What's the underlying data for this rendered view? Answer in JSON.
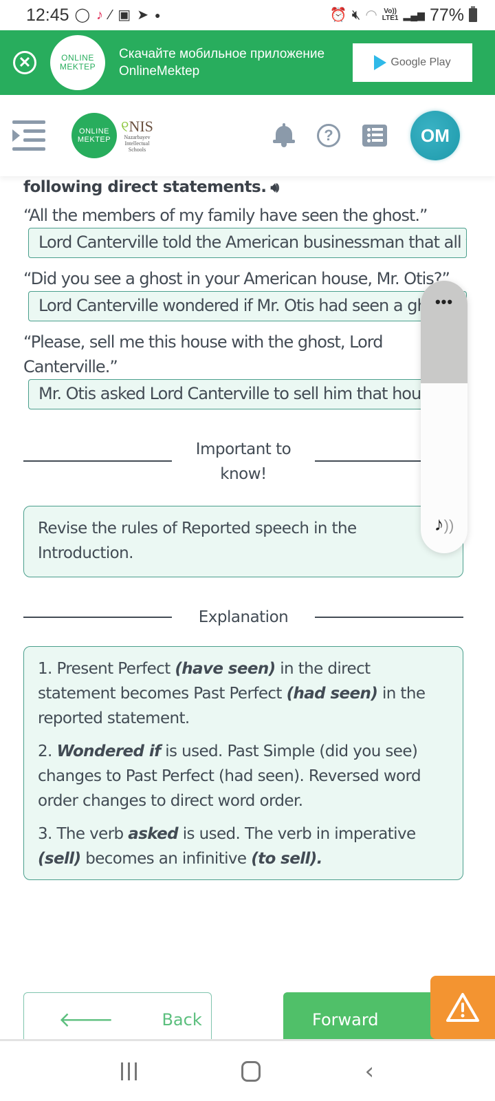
{
  "status_bar": {
    "time": "12:45",
    "notification_icons": [
      "whatsapp-icon",
      "tiktok-icon",
      "magic-wand-icon",
      "camera-icon",
      "telegram-icon",
      "dot-icon"
    ],
    "system_icons": [
      "alarm-icon",
      "mute-icon",
      "wifi-icon",
      "volte-lte-icon",
      "signal-icon"
    ],
    "lte_label_top": "Vo))",
    "lte_label_bottom": "LTE1",
    "battery": "77%"
  },
  "app_banner": {
    "close_icon": "close-circle-icon",
    "logo_line1": "ONLINE",
    "logo_line2": "MEKTEP",
    "text": "Скачайте мобильное приложение OnlineMektep",
    "store_button": "Google Play",
    "bg_color": "#28ad5d"
  },
  "header": {
    "logo_line1": "ONLINE",
    "logo_line2": "MEKTEP",
    "nis_title": "NIS",
    "nis_sub1": "Nazarbayev",
    "nis_sub2": "Intellectual",
    "nis_sub3": "Schools",
    "avatar_initials": "OM",
    "avatar_color": "#1e9aab"
  },
  "task": {
    "heading": "following direct statements.",
    "items": [
      {
        "direct": "“All the members of my family have seen the ghost.”",
        "answer": "Lord Canterville told the American businessman that all the members of his family had seen the ghost."
      },
      {
        "direct": "“Did you see a ghost in your American house, Mr. Otis?”",
        "answer": "Lord Canterville wondered if Mr. Otis had seen a ghost in his American house."
      },
      {
        "direct": "“Please, sell me this house with the ghost, Lord Canterville.”",
        "answer": "Mr. Otis asked Lord Canterville to sell him that house with the ghost."
      }
    ]
  },
  "important": {
    "title": "Important to know!",
    "text": "Revise the rules of Reported speech in the Introduction."
  },
  "explanation": {
    "title": "Explanation",
    "p1_a": "1. Present Perfect ",
    "p1_b": "(have seen)",
    "p1_c": " in the direct statement becomes Past Perfect ",
    "p1_d": "(had seen)",
    "p1_e": " in the reported statement.",
    "p2_a": "2. ",
    "p2_b": "Wondered if",
    "p2_c": " is used. Past Simple (did you see) changes to Past Perfect (had seen). Reversed word order changes to direct word order.",
    "p3_a": "3. The verb ",
    "p3_b": "asked",
    "p3_c": " is used. The verb in imperative ",
    "p3_d": "(sell)",
    "p3_e": " becomes an infinitive ",
    "p3_f": "(to sell)."
  },
  "navigation": {
    "back_label": "Back",
    "forward_label": "Forward"
  },
  "volume_overlay": {
    "more_label": "•••",
    "stream": "media",
    "level_percent": 45
  }
}
